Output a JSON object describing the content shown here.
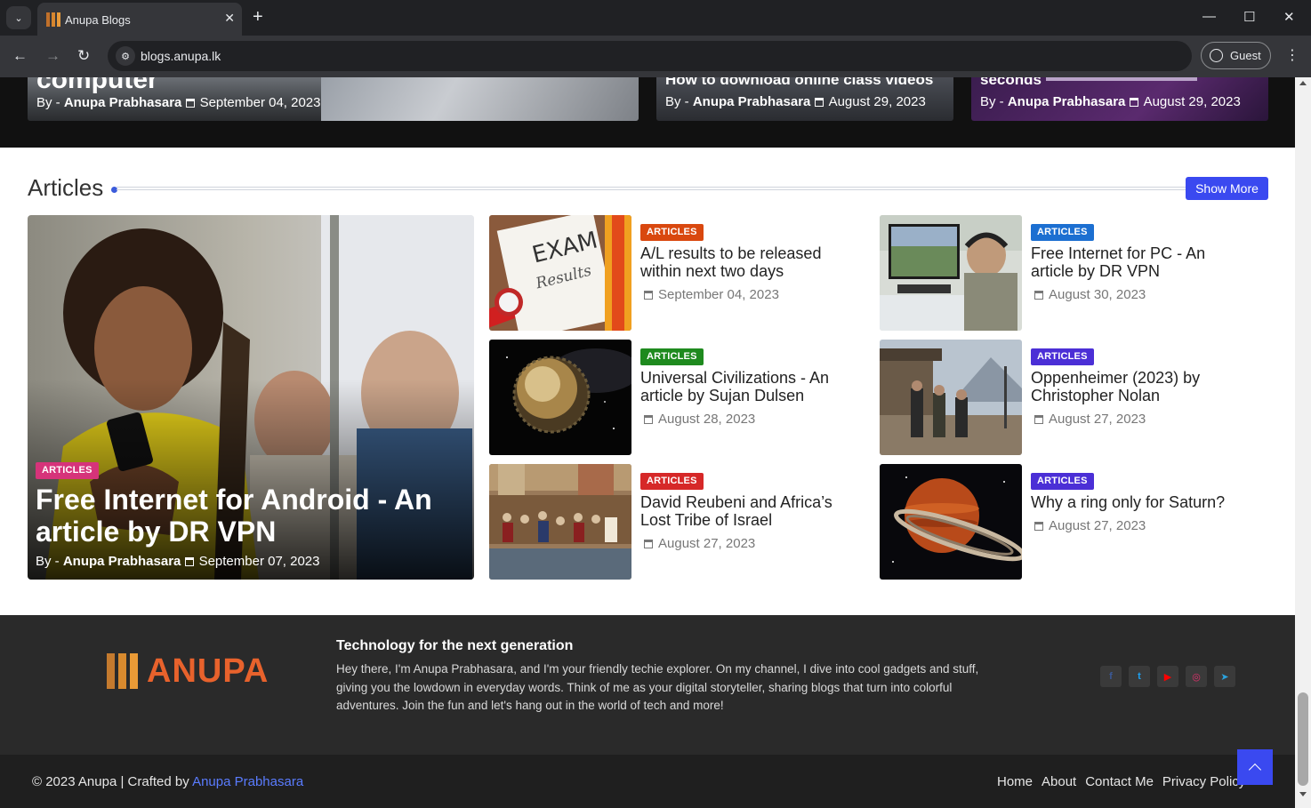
{
  "browser": {
    "tab_title": "Anupa Blogs",
    "url": "blogs.anupa.lk",
    "profile_label": "Guest"
  },
  "featured_strip": [
    {
      "title_fragment": "computer",
      "by_label": "By -",
      "author": "Anupa Prabhasara",
      "date": "September 04, 2023"
    },
    {
      "title_fragment": "How to download online class videos",
      "by_label": "By -",
      "author": "Anupa Prabhasara",
      "date": "August 29, 2023"
    },
    {
      "title_fragment": "seconds",
      "by_label": "By -",
      "author": "Anupa Prabhasara",
      "date": "August 29, 2023"
    }
  ],
  "articles_section": {
    "title": "Articles",
    "show_more_label": "Show More",
    "hero": {
      "category": "ARTICLES",
      "title": "Free Internet for Android - An article by DR VPN",
      "by_label": "By -",
      "author": "Anupa Prabhasara",
      "date": "September 07, 2023"
    },
    "cards": [
      {
        "category": "ARTICLES",
        "title": "A/L results to be released within next two days",
        "date": "September 04, 2023"
      },
      {
        "category": "ARTICLES",
        "title": "Free Internet for PC - An article by DR VPN",
        "date": "August 30, 2023"
      },
      {
        "category": "ARTICLES",
        "title": "Universal Civilizations - An article by Sujan Dulsen",
        "date": "August 28, 2023"
      },
      {
        "category": "ARTICLES",
        "title": "Oppenheimer (2023) by Christopher Nolan",
        "date": "August 27, 2023"
      },
      {
        "category": "ARTICLES",
        "title": "David Reubeni and Africa’s Lost Tribe of Israel",
        "date": "August 27, 2023"
      },
      {
        "category": "ARTICLES",
        "title": "Why a ring only for Saturn?",
        "date": "August 27, 2023"
      }
    ],
    "thumb_images": {
      "exam_text": "EXAM",
      "results_text": "Results"
    }
  },
  "footer": {
    "logo_text": "ANUPA",
    "heading": "Technology for the next generation",
    "about": "Hey there, I'm Anupa Prabhasara, and I'm your friendly techie explorer. On my channel, I dive into cool gadgets and stuff, giving you the lowdown in everyday words. Think of me as your digital storyteller, sharing blogs that turn into colorful adventures. Join the fun and let's hang out in the world of tech and more!",
    "socials": [
      {
        "icon": "facebook-icon",
        "glyph": "f",
        "color": "#3b5998"
      },
      {
        "icon": "twitter-icon",
        "glyph": "t",
        "color": "#1da1f2"
      },
      {
        "icon": "youtube-icon",
        "glyph": "▶",
        "color": "#ff0000"
      },
      {
        "icon": "instagram-icon",
        "glyph": "◎",
        "color": "#e1306c"
      },
      {
        "icon": "telegram-icon",
        "glyph": "➤",
        "color": "#2aa3df"
      }
    ],
    "copyright": "© 2023 Anupa | Crafted by",
    "crafted_by": "Anupa Prabhasara",
    "links": [
      "Home",
      "About",
      "Contact Me",
      "Privacy Policy"
    ]
  },
  "colors": {
    "accent": "#3a49f0",
    "badge_orange": "#d9480f",
    "badge_blue": "#1c6fd1",
    "badge_green": "#1e8a1e",
    "badge_purple": "#4b2fd6",
    "badge_pink": "#d6337a",
    "badge_red": "#d62828"
  }
}
